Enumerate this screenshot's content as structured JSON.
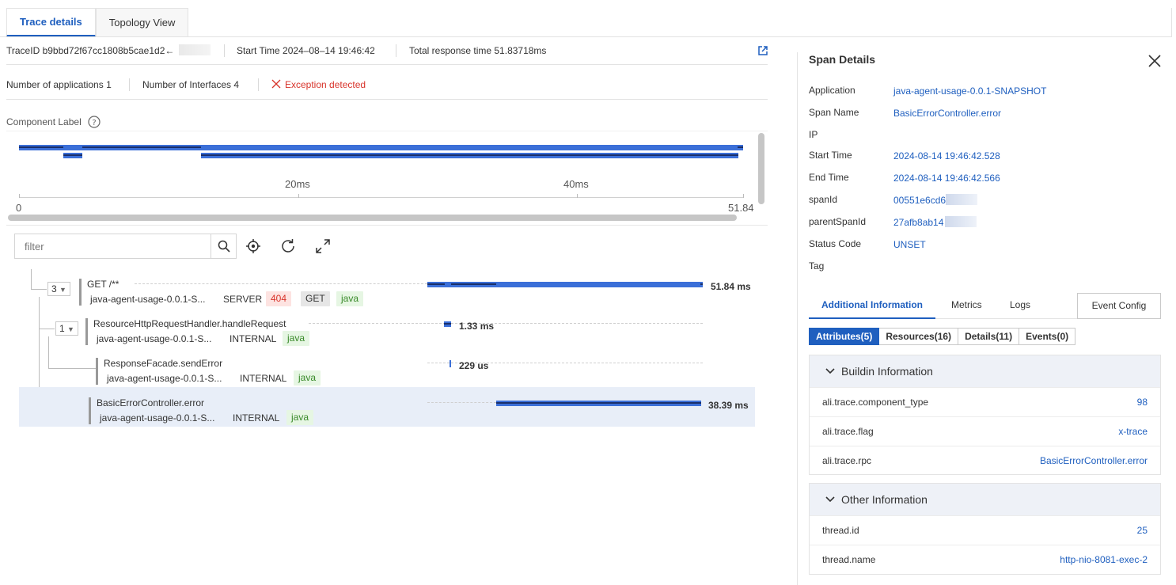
{
  "tabs": [
    {
      "label": "Trace details",
      "active": true
    },
    {
      "label": "Topology View",
      "active": false
    }
  ],
  "summary": {
    "trace_id": "TraceID b9bbd72f67cc1808b5cae1d2←",
    "start_time": "Start Time 2024–08–14 19:46:42",
    "total_response": "Total response time 51.83718ms"
  },
  "stats": {
    "applications": "Number of applications 1",
    "interfaces": "Number of Interfaces 4",
    "exception": "Exception detected"
  },
  "component_label": "Component Label",
  "timeline": {
    "ticks": [
      "20ms",
      "40ms"
    ],
    "axis_start": "0",
    "axis_end": "51.84"
  },
  "toolbar": {
    "filter_placeholder": "filter"
  },
  "spans": [
    {
      "count": "3",
      "name": "GET /**",
      "app": "java-agent-usage-0.0.1-S...",
      "kind": "SERVER",
      "status": "404",
      "method": "GET",
      "lang": "java",
      "duration": "51.84 ms",
      "start_ms": 0,
      "length_ms": 51.84
    },
    {
      "count": "1",
      "name": "ResourceHttpRequestHandler.handleRequest",
      "app": "java-agent-usage-0.0.1-S...",
      "kind": "INTERNAL",
      "lang": "java",
      "duration": "1.33 ms",
      "start_ms": 1.3,
      "length_ms": 1.33
    },
    {
      "name": "ResponseFacade.sendError",
      "app": "java-agent-usage-0.0.1-S...",
      "kind": "INTERNAL",
      "lang": "java",
      "duration": "229 us",
      "start_ms": 1.6,
      "length_ms": 0.229
    },
    {
      "name": "BasicErrorController.error",
      "app": "java-agent-usage-0.0.1-S...",
      "kind": "INTERNAL",
      "lang": "java",
      "duration": "38.39 ms",
      "start_ms": 13.3,
      "length_ms": 38.39,
      "selected": true
    }
  ],
  "span_details": {
    "title": "Span Details",
    "fields": [
      {
        "label": "Application",
        "value": "java-agent-usage-0.0.1-SNAPSHOT"
      },
      {
        "label": "Span Name",
        "value": "BasicErrorController.error"
      },
      {
        "label": "IP",
        "value": ""
      },
      {
        "label": "Start Time",
        "value": "2024-08-14 19:46:42.528"
      },
      {
        "label": "End Time",
        "value": "2024-08-14 19:46:42.566"
      },
      {
        "label": "spanId",
        "value": "00551e6cd65"
      },
      {
        "label": "parentSpanId",
        "value": "27afb8ab14"
      },
      {
        "label": "Status Code",
        "value": "UNSET"
      },
      {
        "label": "Tag",
        "value": ""
      }
    ],
    "info_tabs": [
      "Additional Information",
      "Metrics",
      "Logs"
    ],
    "event_config": "Event Config",
    "segments": [
      "Attributes(5)",
      "Resources(16)",
      "Details(11)",
      "Events(0)"
    ],
    "buildin": {
      "title": "Buildin Information",
      "rows": [
        {
          "key": "ali.trace.component_type",
          "value": "98"
        },
        {
          "key": "ali.trace.flag",
          "value": "x-trace"
        },
        {
          "key": "ali.trace.rpc",
          "value": "BasicErrorController.error"
        }
      ]
    },
    "other": {
      "title": "Other Information",
      "rows": [
        {
          "key": "thread.id",
          "value": "25"
        },
        {
          "key": "thread.name",
          "value": "http-nio-8081-exec-2"
        }
      ]
    }
  },
  "colors": {
    "accent": "#1f5fbf",
    "bar": "#3b6fd8",
    "bar_dark": "#1a2f6a",
    "error": "#d8332a"
  }
}
